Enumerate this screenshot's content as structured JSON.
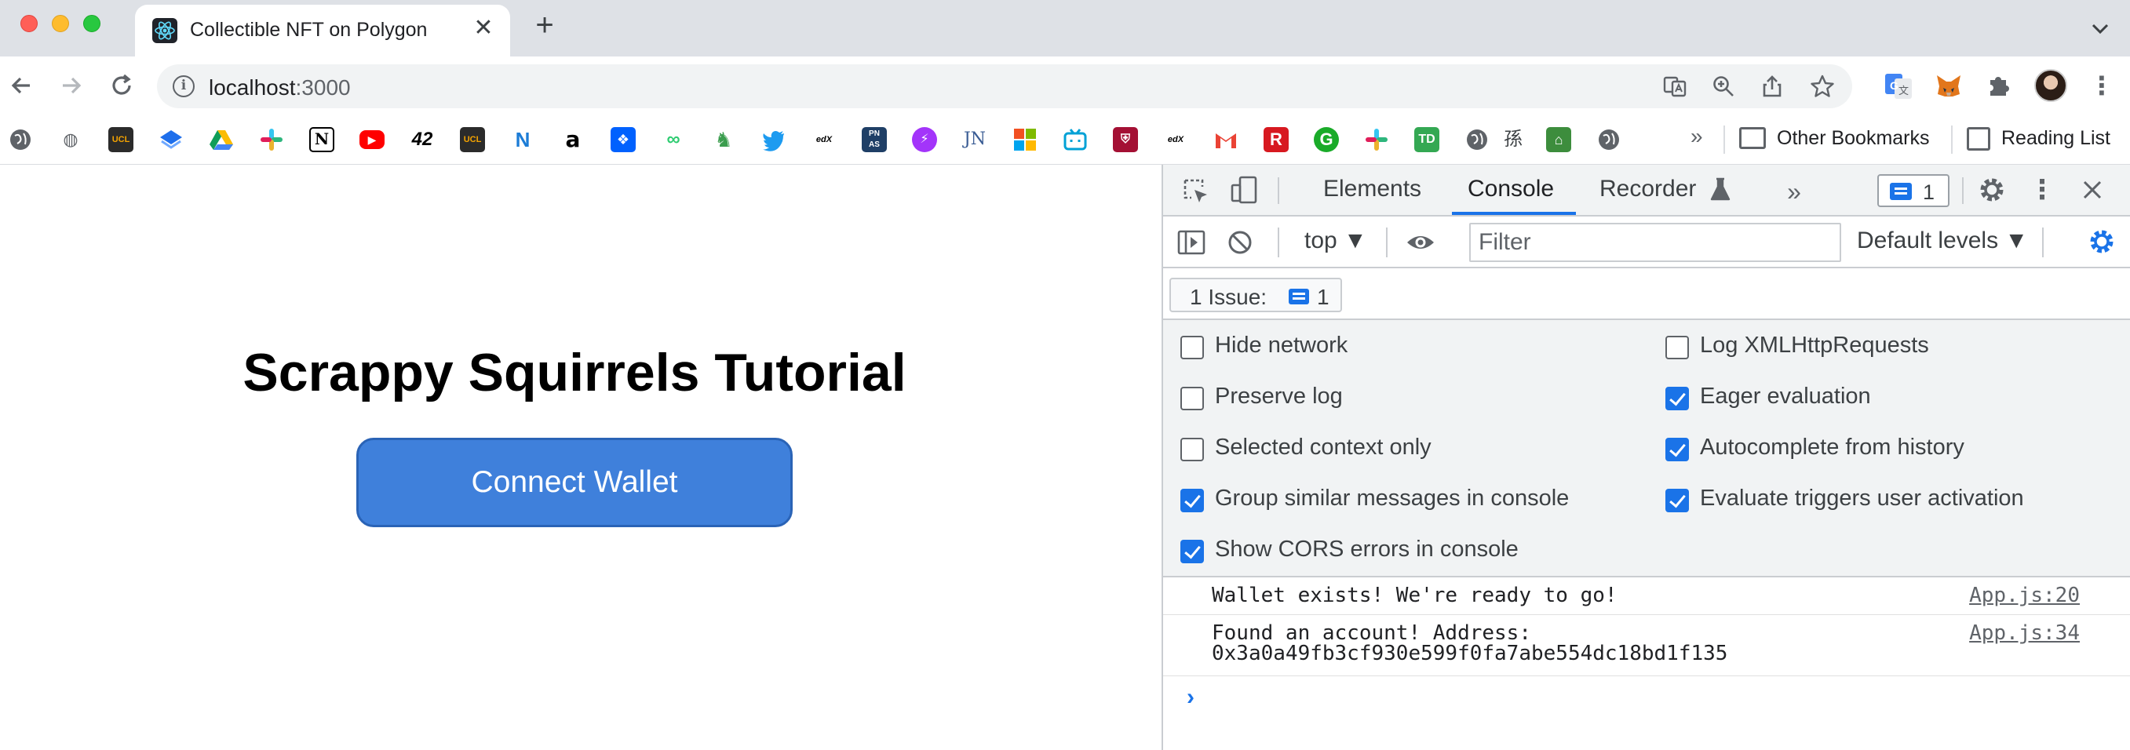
{
  "browser": {
    "tab_title": "Collectible NFT on Polygon",
    "url_host": "localhost",
    "url_port": ":3000"
  },
  "bookmarks": {
    "other_label": "Other Bookmarks",
    "reading_label": "Reading List",
    "more": "»"
  },
  "page": {
    "title": "Scrappy Squirrels Tutorial",
    "button_label": "Connect Wallet"
  },
  "devtools": {
    "tabs": [
      "Elements",
      "Console",
      "Recorder"
    ],
    "active_tab": "Console",
    "issue_count": "1",
    "context": "top ▼",
    "filter_placeholder": "Filter",
    "levels": "Default levels ▼",
    "issues_label": "1 Issue:",
    "issues_num": "1",
    "settings": {
      "left": [
        {
          "label": "Hide network",
          "checked": false
        },
        {
          "label": "Preserve log",
          "checked": false
        },
        {
          "label": "Selected context only",
          "checked": false
        },
        {
          "label": "Group similar messages in console",
          "checked": true
        },
        {
          "label": "Show CORS errors in console",
          "checked": true
        }
      ],
      "right": [
        {
          "label": "Log XMLHttpRequests",
          "checked": false
        },
        {
          "label": "Eager evaluation",
          "checked": true
        },
        {
          "label": "Autocomplete from history",
          "checked": true
        },
        {
          "label": "Evaluate triggers user activation",
          "checked": true
        }
      ]
    },
    "logs": [
      {
        "text": "Wallet exists! We're ready to go!",
        "source": "App.js:20"
      },
      {
        "text": "Found an account! Address:\n0x3a0a49fb3cf930e599f0fa7abe554dc18bd1f135",
        "source": "App.js:34"
      }
    ],
    "prompt": "›"
  },
  "colors": {
    "accent": "#1a73e8",
    "button": "#3f80db"
  }
}
